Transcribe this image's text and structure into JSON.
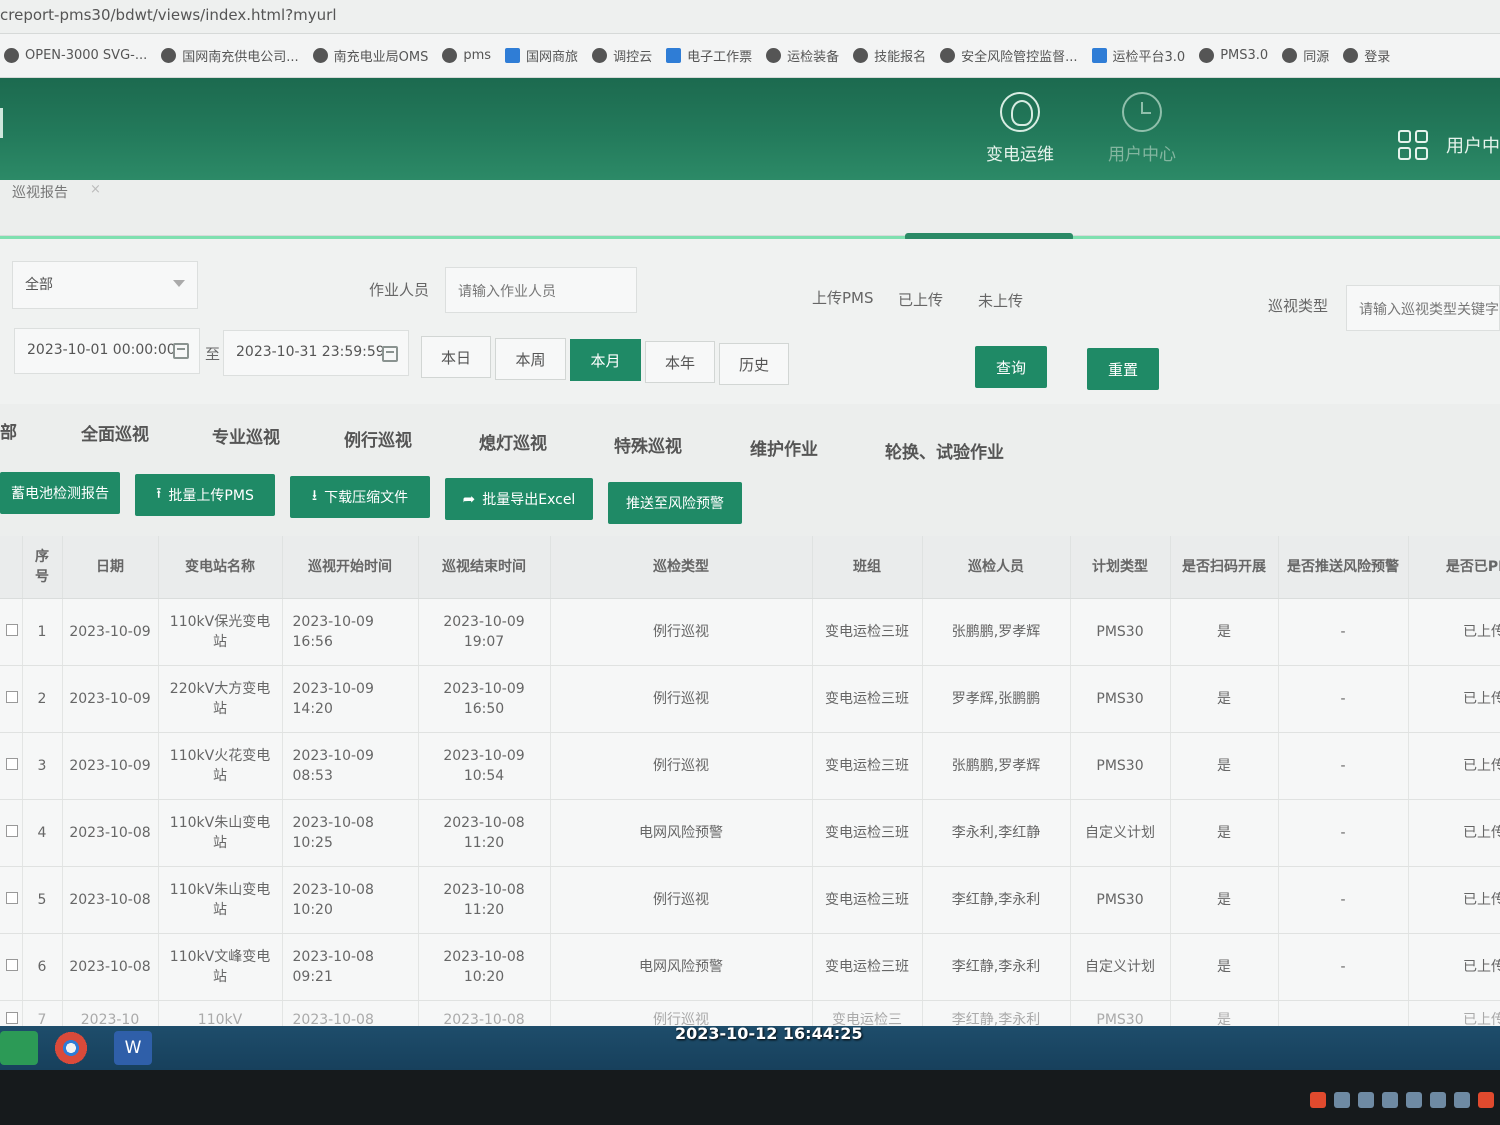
{
  "browser": {
    "url": "creport-pms30/bdwt/views/index.html?myurl",
    "bookmarks": [
      "OPEN-3000 SVG-...",
      "国网南充供电公司...",
      "南充电业局OMS",
      "pms",
      "国网商旅",
      "调控云",
      "电子工作票",
      "运检装备",
      "技能报名",
      "安全风险管控监督...",
      "运检平台3.0",
      "PMS3.0",
      "同源",
      "登录"
    ]
  },
  "header": {
    "nav": [
      {
        "label": "变电运维",
        "icon": "substation-icon"
      },
      {
        "label": "用户中心",
        "icon": "user-center-icon"
      }
    ],
    "user_center_label": "用户中"
  },
  "tabs": {
    "active_tab": "巡视报告",
    "close_glyph": "×"
  },
  "filters": {
    "scope_select": "全部",
    "worker_label": "作业人员",
    "worker_placeholder": "请输入作业人员",
    "upload_label": "上传PMS",
    "upload_options": [
      "已上传",
      "未上传"
    ],
    "patrol_type_label": "巡视类型",
    "patrol_type_placeholder": "请输入巡视类型关键字",
    "date_start": "2023-10-01 00:00:00",
    "date_sep": "至",
    "date_end": "2023-10-31 23:59:59",
    "period_buttons": [
      "本日",
      "本周",
      "本月",
      "本年",
      "历史"
    ],
    "period_active": "本月",
    "query_label": "查询",
    "reset_label": "重置"
  },
  "categories": [
    "部",
    "全面巡视",
    "专业巡视",
    "例行巡视",
    "熄灯巡视",
    "特殊巡视",
    "维护作业",
    "轮换、试验作业"
  ],
  "actions": [
    "蓄电池检测报告",
    "批量上传PMS",
    "下载压缩文件",
    "批量导出Excel",
    "推送至风险预警"
  ],
  "table": {
    "headers": [
      "序号",
      "日期",
      "变电站名称",
      "巡视开始时间",
      "巡视结束时间",
      "巡检类型",
      "班组",
      "巡检人员",
      "计划类型",
      "是否扫码开展",
      "是否推送风险预警",
      "是否已PMS"
    ],
    "rows": [
      {
        "no": "1",
        "date": "2023-10-09",
        "station": "110kV保光变电站",
        "start": "2023-10-09 16:56",
        "end": "2023-10-09 19:07",
        "type": "例行巡视",
        "team": "变电运检三班",
        "people": "张鹏鹏,罗孝辉",
        "plan": "PMS30",
        "scan": "是",
        "push": "-",
        "uploaded": "已上传"
      },
      {
        "no": "2",
        "date": "2023-10-09",
        "station": "220kV大方变电站",
        "start": "2023-10-09 14:20",
        "end": "2023-10-09 16:50",
        "type": "例行巡视",
        "team": "变电运检三班",
        "people": "罗孝辉,张鹏鹏",
        "plan": "PMS30",
        "scan": "是",
        "push": "-",
        "uploaded": "已上传"
      },
      {
        "no": "3",
        "date": "2023-10-09",
        "station": "110kV火花变电站",
        "start": "2023-10-09 08:53",
        "end": "2023-10-09 10:54",
        "type": "例行巡视",
        "team": "变电运检三班",
        "people": "张鹏鹏,罗孝辉",
        "plan": "PMS30",
        "scan": "是",
        "push": "-",
        "uploaded": "已上传"
      },
      {
        "no": "4",
        "date": "2023-10-08",
        "station": "110kV朱山变电站",
        "start": "2023-10-08 10:25",
        "end": "2023-10-08 11:20",
        "type": "电网风险预警",
        "team": "变电运检三班",
        "people": "李永利,李红静",
        "plan": "自定义计划",
        "scan": "是",
        "push": "-",
        "uploaded": "已上传"
      },
      {
        "no": "5",
        "date": "2023-10-08",
        "station": "110kV朱山变电站",
        "start": "2023-10-08 10:20",
        "end": "2023-10-08 11:20",
        "type": "例行巡视",
        "team": "变电运检三班",
        "people": "李红静,李永利",
        "plan": "PMS30",
        "scan": "是",
        "push": "-",
        "uploaded": "已上传"
      },
      {
        "no": "6",
        "date": "2023-10-08",
        "station": "110kV文峰变电站",
        "start": "2023-10-08 09:21",
        "end": "2023-10-08 10:20",
        "type": "电网风险预警",
        "team": "变电运检三班",
        "people": "李红静,李永利",
        "plan": "自定义计划",
        "scan": "是",
        "push": "-",
        "uploaded": "已上传"
      },
      {
        "no": "7",
        "date": "2023-10",
        "station": "110kV",
        "start": "2023-10-08",
        "end": "2023-10-08",
        "type": "例行巡视",
        "team": "变电运检三",
        "people": "李红静,李永利",
        "plan": "PMS30",
        "scan": "是",
        "push": "",
        "uploaded": "已上传"
      }
    ]
  },
  "overlay": {
    "timestamp": "2023-10-12 16:44:25"
  },
  "taskbar": {
    "word_glyph": "W"
  }
}
